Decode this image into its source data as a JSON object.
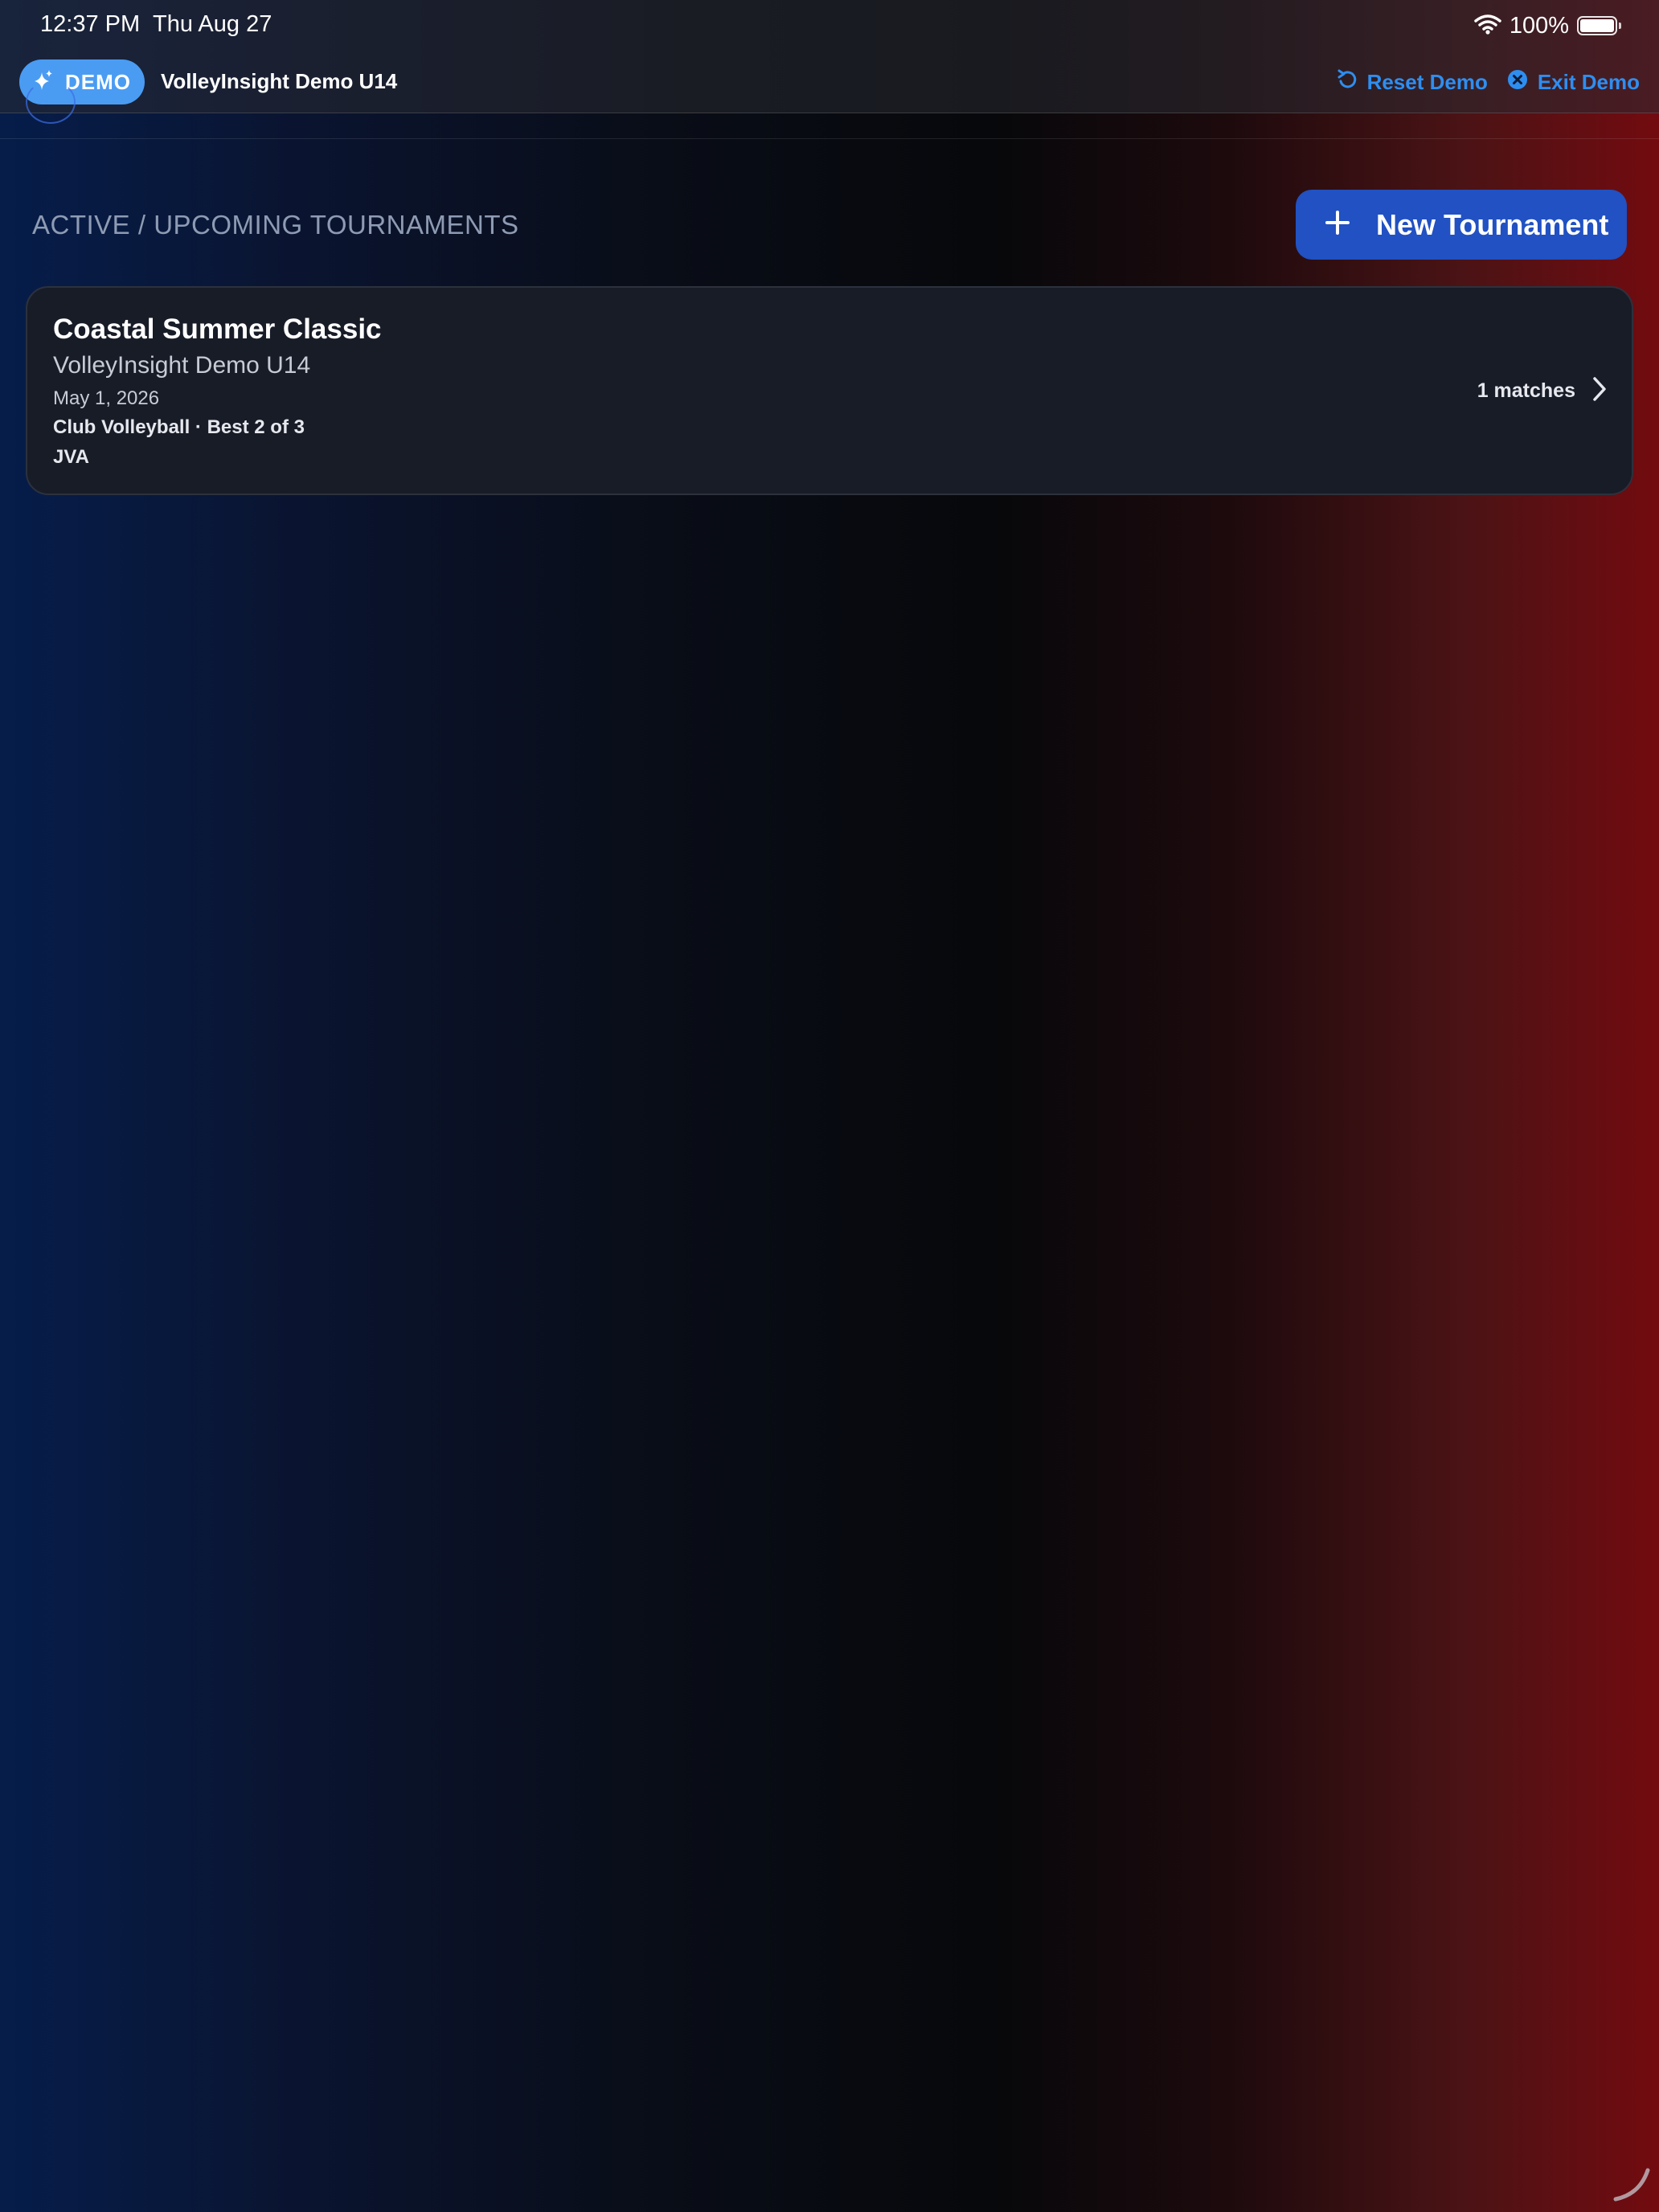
{
  "status_bar": {
    "time": "12:37 PM",
    "date": "Thu Aug 27",
    "battery_percent": "100%",
    "wifi_icon": "wifi-icon",
    "battery_icon": "battery-full-icon"
  },
  "demo_bar": {
    "badge_label": "DEMO",
    "badge_icon": "sparkles-icon",
    "team_name": "VolleyInsight Demo U14",
    "reset_label": "Reset Demo",
    "reset_icon": "reset-arrow-icon",
    "exit_label": "Exit Demo",
    "exit_icon": "close-circle-icon"
  },
  "section": {
    "title": "ACTIVE / UPCOMING TOURNAMENTS",
    "new_button_label": "New Tournament",
    "new_button_icon": "plus-icon"
  },
  "tournaments": [
    {
      "name": "Coastal Summer Classic",
      "team": "VolleyInsight Demo U14",
      "date": "May 1, 2026",
      "format": "Club Volleyball · Best 2 of 3",
      "organization": "JVA",
      "matches": "1 matches"
    }
  ],
  "colors": {
    "accent_blue": "#2e8ef0",
    "demo_badge": "#4a9cf2",
    "primary_button": "#2151c2",
    "card_background": "#181c27",
    "section_title": "#8e9bb3",
    "gradient_left": "#061d4a",
    "gradient_right": "#720b10"
  }
}
